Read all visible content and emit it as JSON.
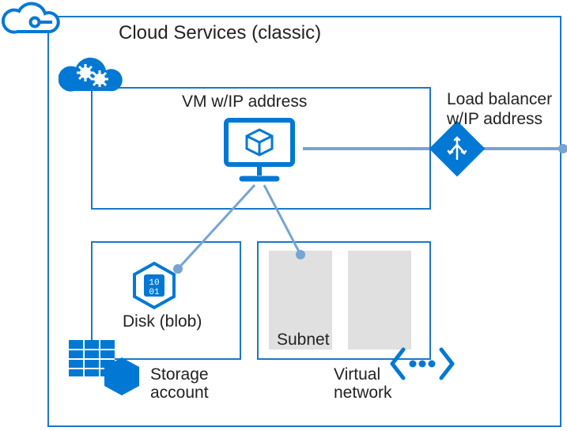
{
  "title": "Cloud Services (classic)",
  "vm": {
    "label": "VM w/IP address"
  },
  "load_balancer": {
    "label": "Load balancer\nw/IP address"
  },
  "storage": {
    "disk_label": "Disk (blob)",
    "account_label": "Storage\naccount"
  },
  "vnet": {
    "subnet_label": "Subnet",
    "label": "Virtual\nnetwork"
  },
  "colors": {
    "azure": "#0078d4",
    "border": "#1a77c9",
    "connector": "#76a4d3",
    "subnet_fill": "#e0e0e0"
  }
}
